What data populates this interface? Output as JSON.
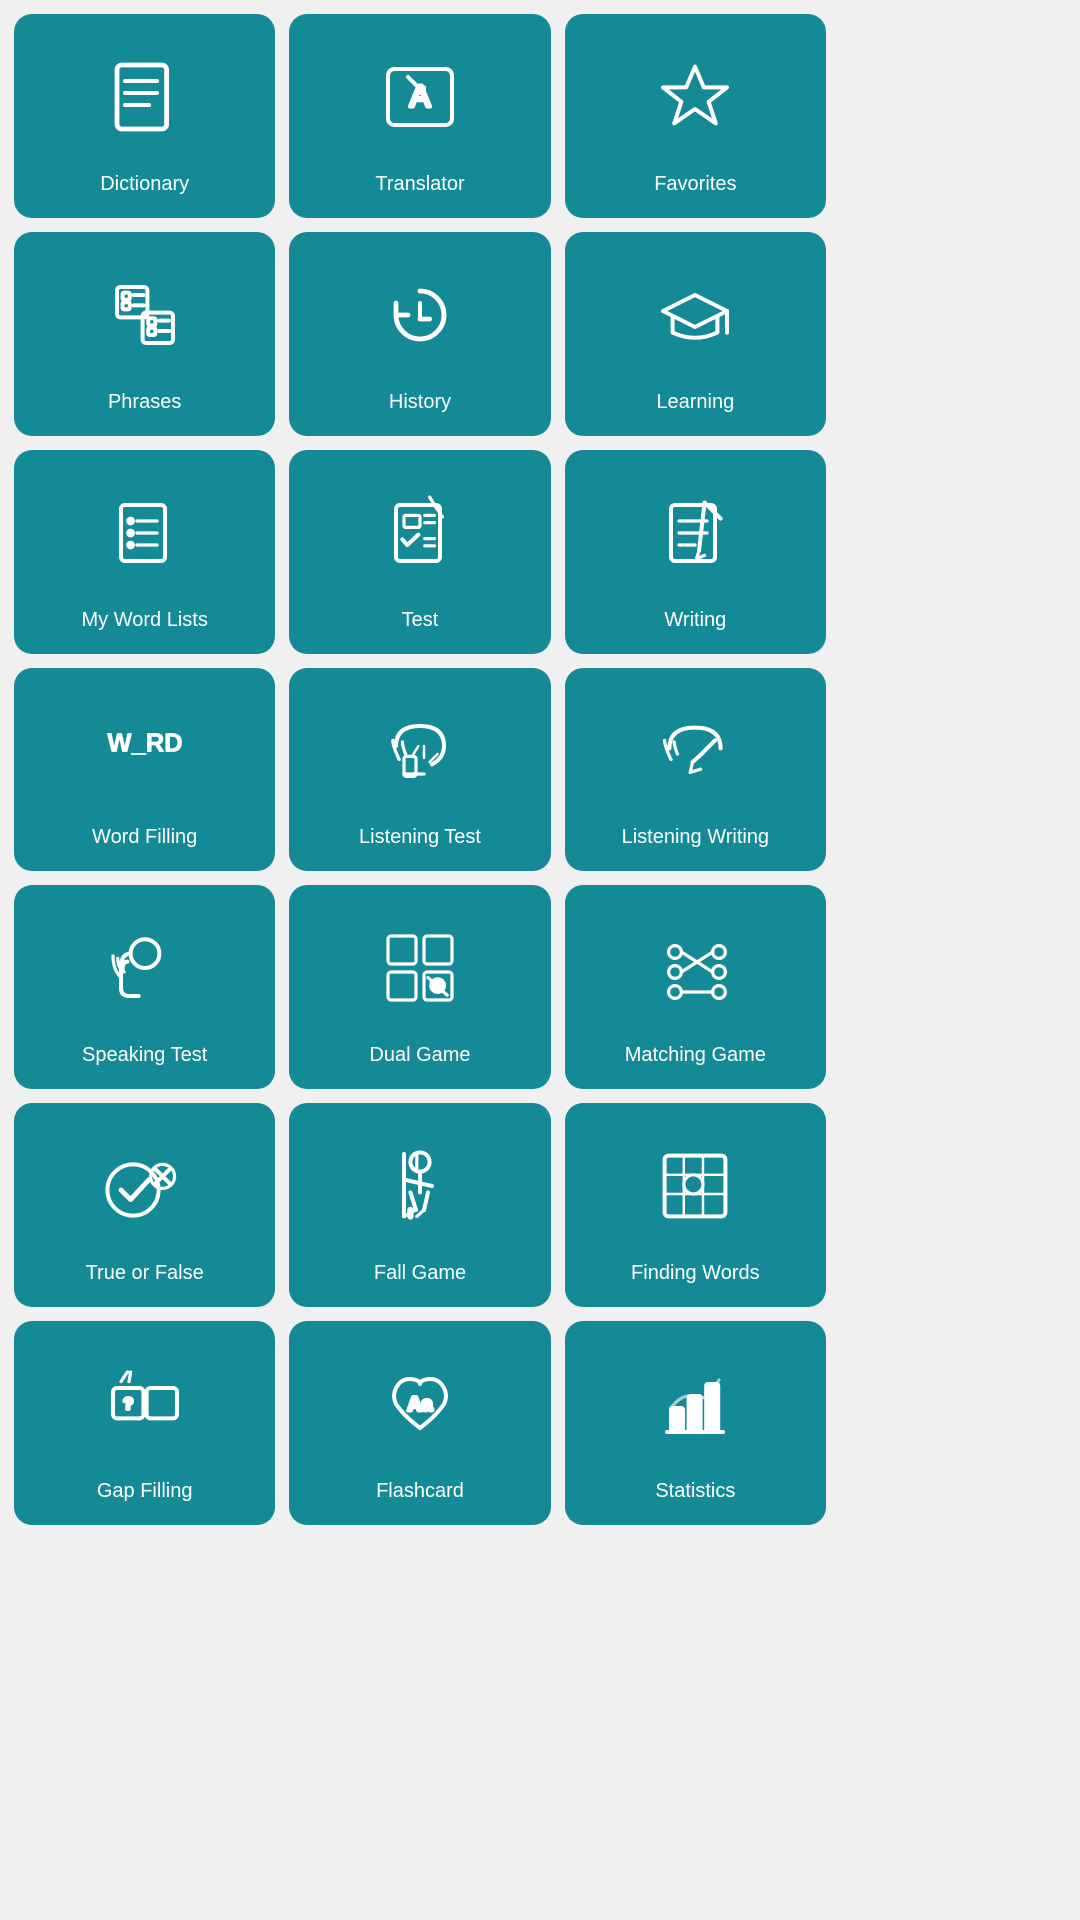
{
  "tiles": [
    {
      "id": "dictionary",
      "label": "Dictionary",
      "icon": "dictionary"
    },
    {
      "id": "translator",
      "label": "Translator",
      "icon": "translator"
    },
    {
      "id": "favorites",
      "label": "Favorites",
      "icon": "favorites"
    },
    {
      "id": "phrases",
      "label": "Phrases",
      "icon": "phrases"
    },
    {
      "id": "history",
      "label": "History",
      "icon": "history"
    },
    {
      "id": "learning",
      "label": "Learning",
      "icon": "learning"
    },
    {
      "id": "my-word-lists",
      "label": "My Word Lists",
      "icon": "wordlists"
    },
    {
      "id": "test",
      "label": "Test",
      "icon": "test"
    },
    {
      "id": "writing",
      "label": "Writing",
      "icon": "writing"
    },
    {
      "id": "word-filling",
      "label": "Word Filling",
      "icon": "wordfilling"
    },
    {
      "id": "listening-test",
      "label": "Listening Test",
      "icon": "listeningtest"
    },
    {
      "id": "listening-writing",
      "label": "Listening Writing",
      "icon": "listeningwriting"
    },
    {
      "id": "speaking-test",
      "label": "Speaking Test",
      "icon": "speaking"
    },
    {
      "id": "dual-game",
      "label": "Dual Game",
      "icon": "dualgame"
    },
    {
      "id": "matching-game",
      "label": "Matching Game",
      "icon": "matching"
    },
    {
      "id": "true-or-false",
      "label": "True or False",
      "icon": "truefalse"
    },
    {
      "id": "fall-game",
      "label": "Fall Game",
      "icon": "fallgame"
    },
    {
      "id": "finding-words",
      "label": "Finding Words",
      "icon": "findingwords"
    },
    {
      "id": "gap-filling",
      "label": "Gap Filling",
      "icon": "gapfilling"
    },
    {
      "id": "flashcard",
      "label": "Flashcard",
      "icon": "flashcard"
    },
    {
      "id": "statistics",
      "label": "Statistics",
      "icon": "statistics"
    }
  ]
}
